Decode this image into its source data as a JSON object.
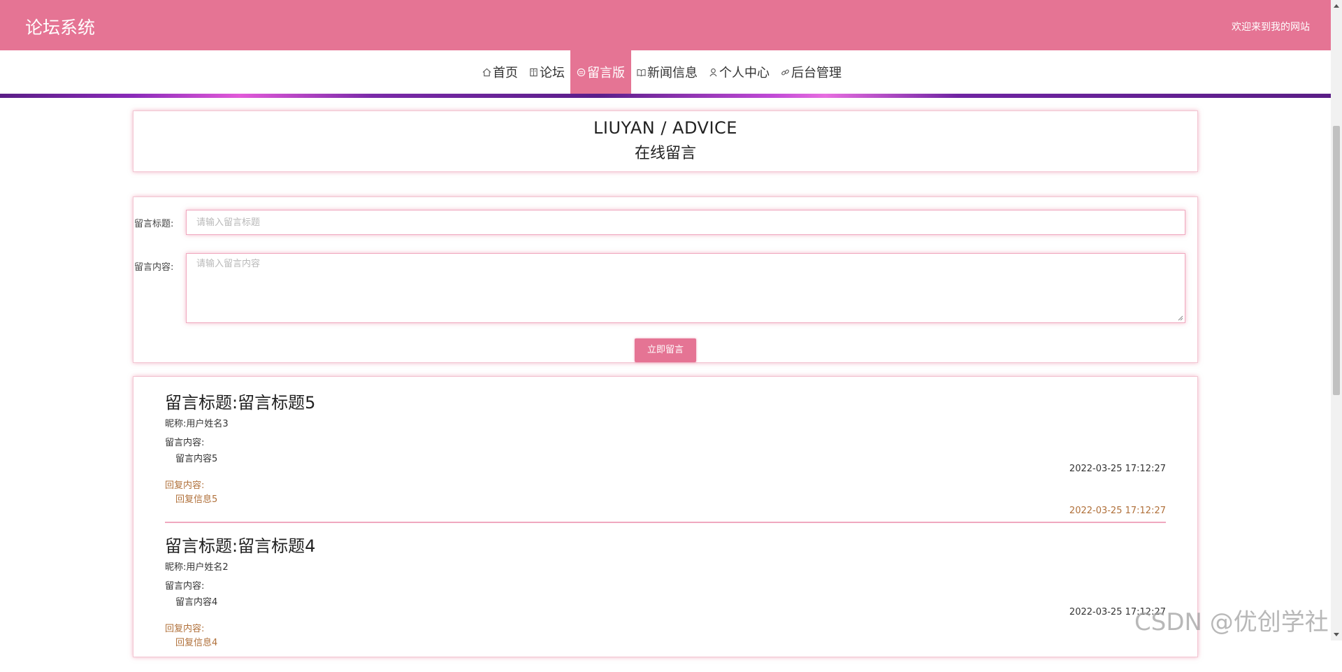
{
  "header": {
    "brand": "论坛系统",
    "welcome": "欢迎来到我的网站"
  },
  "nav": {
    "items": [
      {
        "label": "首页",
        "icon": "home-icon"
      },
      {
        "label": "论坛",
        "icon": "book-icon"
      },
      {
        "label": "留言版",
        "icon": "message-icon",
        "active": true
      },
      {
        "label": "新闻信息",
        "icon": "news-icon"
      },
      {
        "label": "个人中心",
        "icon": "user-icon"
      },
      {
        "label": "后台管理",
        "icon": "link-icon"
      }
    ]
  },
  "page_title": {
    "en": "LIUYAN / ADVICE",
    "cn": "在线留言"
  },
  "form": {
    "title_label": "留言标题:",
    "title_placeholder": "请输入留言标题",
    "content_label": "留言内容:",
    "content_placeholder": "请输入留言内容",
    "submit_label": "立即留言"
  },
  "messages": [
    {
      "title": "留言标题:留言标题5",
      "nickname": "昵称:用户姓名3",
      "content_label": "留言内容:",
      "content": "留言内容5",
      "time": "2022-03-25 17:12:27",
      "reply_label": "回复内容:",
      "reply": "回复信息5",
      "reply_time": "2022-03-25 17:12:27"
    },
    {
      "title": "留言标题:留言标题4",
      "nickname": "昵称:用户姓名2",
      "content_label": "留言内容:",
      "content": "留言内容4",
      "time": "2022-03-25 17:12:27",
      "reply_label": "回复内容:",
      "reply": "回复信息4"
    }
  ],
  "watermark": "CSDN @优创学社",
  "colors": {
    "primary": "#e57494",
    "reply": "#b0703a",
    "nav_line": "#5a1e86"
  }
}
